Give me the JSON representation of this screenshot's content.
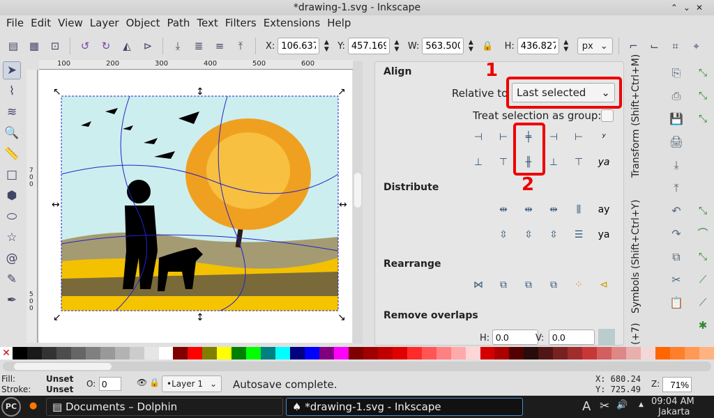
{
  "window": {
    "title": "*drawing-1.svg - Inkscape"
  },
  "menu": [
    "File",
    "Edit",
    "View",
    "Layer",
    "Object",
    "Path",
    "Text",
    "Filters",
    "Extensions",
    "Help"
  ],
  "toolbar": {
    "x_label": "X:",
    "x": "106.637",
    "y_label": "Y:",
    "y": "457.169",
    "w_label": "W:",
    "w": "563.500",
    "h_label": "H:",
    "h": "436.827",
    "unit": "px"
  },
  "ruler": {
    "h": [
      "100",
      "200",
      "300",
      "400",
      "500",
      "600"
    ],
    "v": [
      "7",
      "0",
      "0",
      "5",
      "0",
      "0"
    ]
  },
  "align": {
    "title": "Align",
    "relative_label": "Relative to",
    "relative_value": "Last selected",
    "group_label": "Treat selection as group:"
  },
  "distribute": {
    "title": "Distribute"
  },
  "rearrange": {
    "title": "Rearrange"
  },
  "overlaps": {
    "title": "Remove overlaps",
    "h_label": "H:",
    "h": "0.0",
    "v_label": "V:",
    "v": "0.0"
  },
  "vtabs": [
    "Transform (Shift+Ctrl+M)",
    "Symbols (Shift+Ctrl+Y)",
    "(+7)"
  ],
  "annotations": [
    "1",
    "2"
  ],
  "status": {
    "fill_label": "Fill:",
    "fill": "Unset",
    "stroke_label": "Stroke:",
    "stroke": "Unset",
    "opacity_label": "O:",
    "opacity": "0",
    "layer": "•Layer 1",
    "message": "Autosave complete.",
    "cx": "X:  680.24",
    "cy": "Y:  725.49",
    "zoom_label": "Z:",
    "zoom": "71%"
  },
  "taskbar": {
    "start": "PC",
    "tasks": [
      "Documents – Dolphin",
      "*drawing-1.svg - Inkscape"
    ],
    "time": "09:04 AM",
    "location": "Jakarta"
  },
  "palette": [
    "#000000",
    "#1a1a1a",
    "#333333",
    "#4d4d4d",
    "#666666",
    "#808080",
    "#999999",
    "#b3b3b3",
    "#cccccc",
    "#e6e6e6",
    "#ffffff",
    "#800000",
    "#ff0000",
    "#808000",
    "#ffff00",
    "#008000",
    "#00ff00",
    "#008080",
    "#00ffff",
    "#000080",
    "#0000ff",
    "#800080",
    "#ff00ff",
    "#800000",
    "#a00000",
    "#c00000",
    "#e00000",
    "#ff2a2a",
    "#ff5555",
    "#ff8080",
    "#ffaaaa",
    "#ffd5d5",
    "#d40000",
    "#aa0000",
    "#550000",
    "#280b0b",
    "#501616",
    "#782121",
    "#a02c2c",
    "#c83737",
    "#d35f5f",
    "#de8787",
    "#e9afaf",
    "#f4d7d7",
    "#ff6600",
    "#ff7f2a",
    "#ff9955",
    "#ffb380"
  ]
}
